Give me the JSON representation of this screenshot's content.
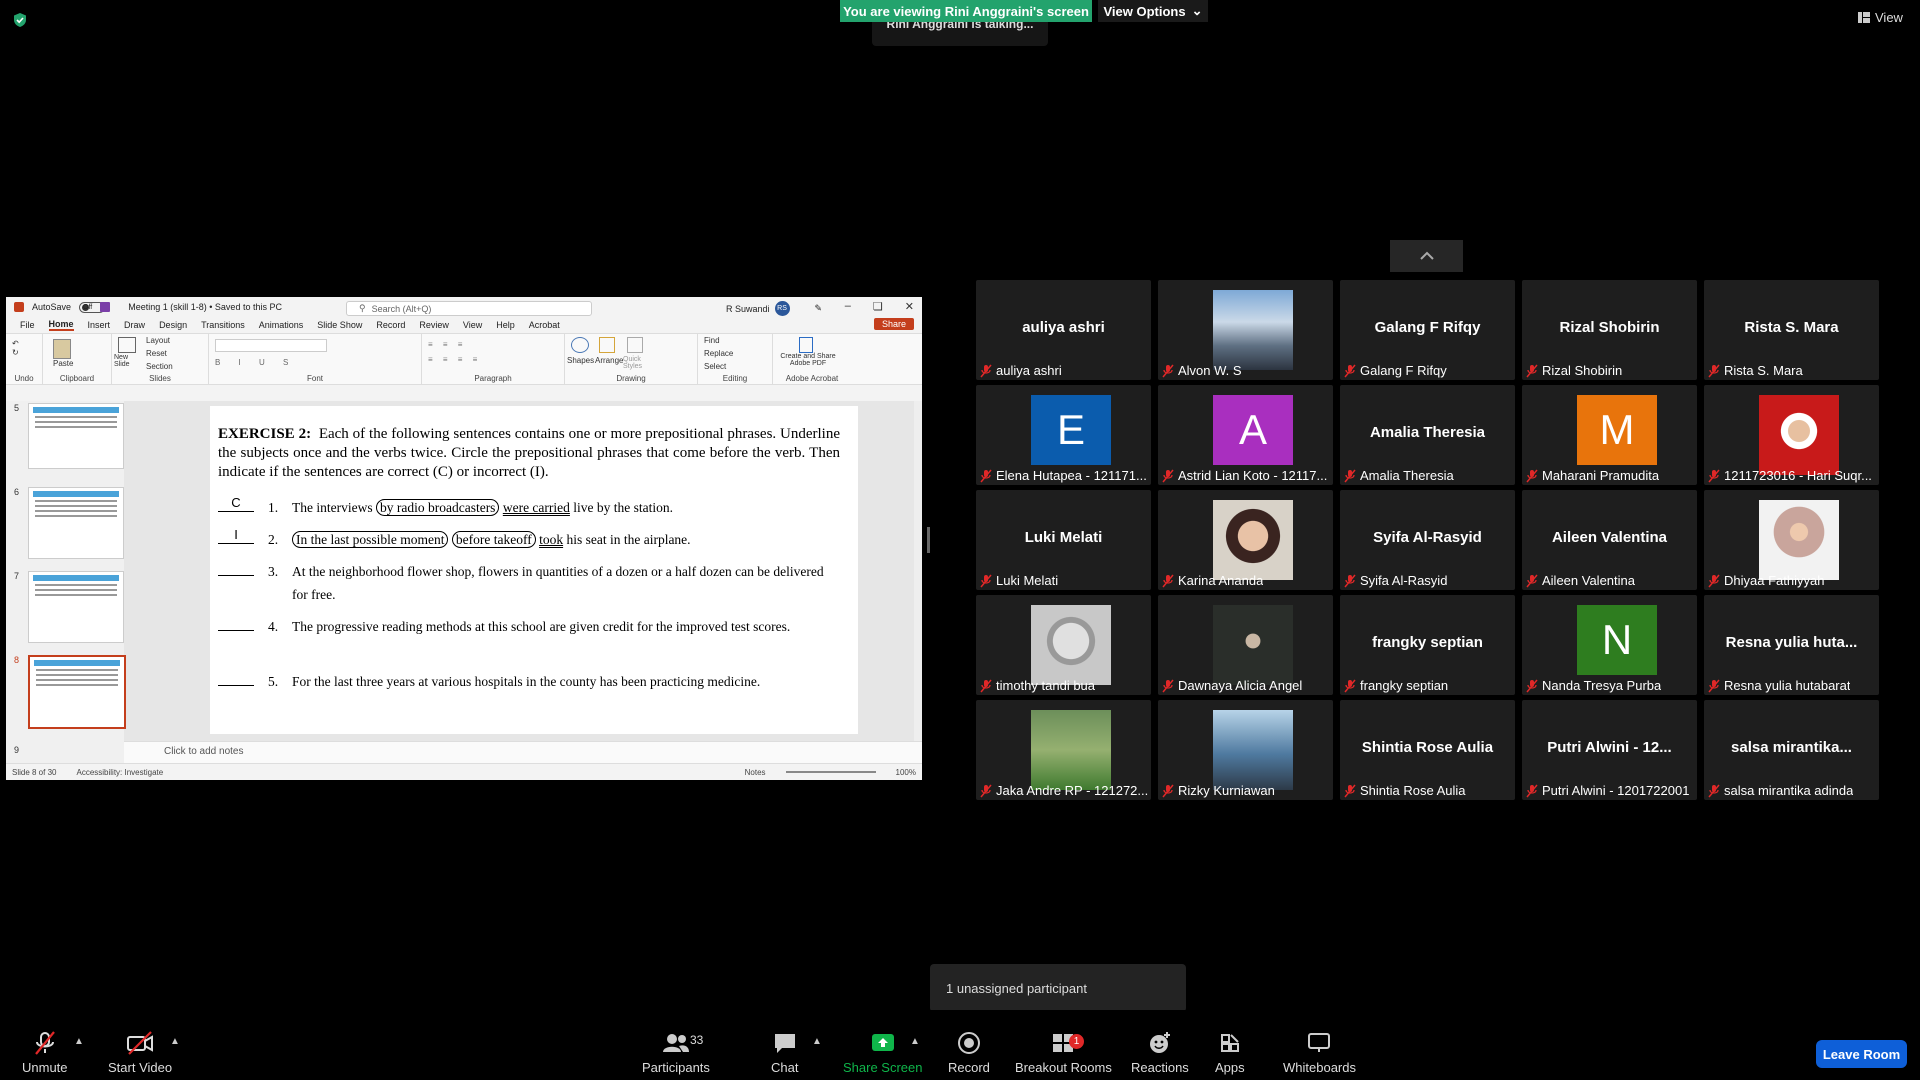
{
  "top": {
    "viewing_banner": "You are viewing Rini Anggraini's screen",
    "view_options": "View Options",
    "talking": "Rini Anggraini is talking...",
    "view": "View"
  },
  "ppt": {
    "autosave": "AutoSave",
    "autosave_state": "Off",
    "file_title": "Meeting 1 (skill 1-8) • Saved to this PC",
    "search_placeholder": "Search (Alt+Q)",
    "user_name": "R Suwandi",
    "user_initials": "RS",
    "tabs": [
      "File",
      "Home",
      "Insert",
      "Draw",
      "Design",
      "Transitions",
      "Animations",
      "Slide Show",
      "Record",
      "Review",
      "View",
      "Help",
      "Acrobat"
    ],
    "share": "Share",
    "ribbon": {
      "undo": "Undo",
      "paste": "Paste",
      "clipboard": "Clipboard",
      "new_slide": "New Slide",
      "layout": "Layout",
      "reset": "Reset",
      "section": "Section",
      "slides": "Slides",
      "font": "Font",
      "paragraph": "Paragraph",
      "shapes": "Shapes",
      "arrange": "Arrange",
      "quick_styles": "Quick Styles",
      "drawing": "Drawing",
      "find": "Find",
      "replace": "Replace",
      "select": "Select",
      "editing": "Editing",
      "create_share_pdf": "Create and Share Adobe PDF",
      "adobe_acrobat": "Adobe Acrobat"
    },
    "thumb_numbers": [
      "5",
      "6",
      "7",
      "8",
      "9"
    ],
    "slide": {
      "heading_bold": "EXERCISE 2:",
      "heading_text": "Each of the following sentences contains one or more prepositional phrases. Underline the subjects once and the verbs twice. Circle the prepositional phrases that come before the verb. Then indicate if the sentences are correct (C) or incorrect (I).",
      "items": [
        {
          "answer": "C",
          "num": "1.",
          "pre": "The interviews",
          "circle1": "by radio broadcasters",
          "verb": "were carried",
          "post": "live by the station."
        },
        {
          "answer": "I",
          "num": "2.",
          "circle1": "In the  last possible moment",
          "circle2": "before takeoff",
          "verb": "took",
          "post": "his seat in the airplane."
        },
        {
          "answer": "",
          "num": "3.",
          "text": "At the neighborhood flower shop, flowers in quantities of a dozen or a half dozen can be delivered for free."
        },
        {
          "answer": "",
          "num": "4.",
          "text": "The progressive reading methods at this school are given credit for the improved test scores."
        },
        {
          "answer": "",
          "num": "5.",
          "text": "For the last three years at various hospitals in the county has been practicing medicine."
        }
      ]
    },
    "notes_placeholder": "Click to add notes",
    "status": {
      "slide_counter": "Slide 8 of 30",
      "accessibility": "Accessibility: Investigate",
      "notes": "Notes",
      "zoom": "100%"
    }
  },
  "participants_tiles": [
    {
      "big": "auliya ashri",
      "name": "auliya ashri",
      "type": "text"
    },
    {
      "name": "Alvon W. S",
      "type": "photo",
      "photo": "city"
    },
    {
      "big": "Galang F Rifqy",
      "name": "Galang F Rifqy",
      "type": "text"
    },
    {
      "big": "Rizal Shobirin",
      "name": "Rizal Shobirin",
      "type": "text"
    },
    {
      "big": "Rista S. Mara",
      "name": "Rista S. Mara",
      "type": "text"
    },
    {
      "letter": "E",
      "color": "#0b5cad",
      "name": "Elena Hutapea - 121171...",
      "type": "letter"
    },
    {
      "letter": "A",
      "color": "#a92fbf",
      "name": "Astrid Lian Koto - 12117...",
      "type": "letter"
    },
    {
      "big": "Amalia Theresia",
      "name": "Amalia Theresia",
      "type": "text"
    },
    {
      "letter": "M",
      "color": "#e8740c",
      "name": "Maharani Pramudita",
      "type": "letter"
    },
    {
      "name": "1211723016 - Hari Suqr...",
      "type": "photo",
      "photo": "redbg"
    },
    {
      "big": "Luki Melati",
      "name": "Luki Melati",
      "type": "text"
    },
    {
      "name": "Karina Ananda",
      "type": "photo",
      "photo": "face"
    },
    {
      "big": "Syifa Al-Rasyid",
      "name": "Syifa Al-Rasyid",
      "type": "text"
    },
    {
      "big": "Aileen Valentina",
      "name": "Aileen Valentina",
      "type": "text"
    },
    {
      "name": "Dhiyaa Fathiyyah",
      "type": "photo",
      "photo": "hijab"
    },
    {
      "name": "timothy tandi bua",
      "type": "photo",
      "photo": "statue"
    },
    {
      "name": "Dawnaya Alicia Angel",
      "type": "photo",
      "photo": "dark"
    },
    {
      "big": "frangky septian",
      "name": "frangky septian",
      "type": "text"
    },
    {
      "letter": "N",
      "color": "#2e7d1f",
      "name": "Nanda Tresya Purba",
      "type": "letter"
    },
    {
      "big": "Resna yulia huta...",
      "name": "Resna yulia hutabarat",
      "type": "text"
    },
    {
      "name": "Jaka Andre RP - 121272...",
      "type": "photo",
      "photo": "field"
    },
    {
      "name": "Rizky Kurniawan",
      "type": "photo",
      "photo": "sea"
    },
    {
      "big": "Shintia Rose Aulia",
      "name": "Shintia Rose Aulia",
      "type": "text"
    },
    {
      "big": "Putri Alwini - 12...",
      "name": "Putri Alwini - 1201722001",
      "type": "text"
    },
    {
      "big": "salsa mirantika...",
      "name": "salsa mirantika adinda",
      "type": "text"
    }
  ],
  "unassigned": "1 unassigned participant",
  "toolbar": {
    "unmute": "Unmute",
    "start_video": "Start Video",
    "participants": "Participants",
    "participants_count": "33",
    "chat": "Chat",
    "share_screen": "Share Screen",
    "record": "Record",
    "breakout_rooms": "Breakout Rooms",
    "breakout_badge": "1",
    "reactions": "Reactions",
    "apps": "Apps",
    "whiteboards": "Whiteboards",
    "leave_room": "Leave Room"
  },
  "colors": {
    "banner_green": "#23a36d",
    "share_green": "#0fb54a",
    "leave_blue": "#0e5fd8",
    "muted_red": "#e02828",
    "ppt_accent": "#c43e1c"
  }
}
